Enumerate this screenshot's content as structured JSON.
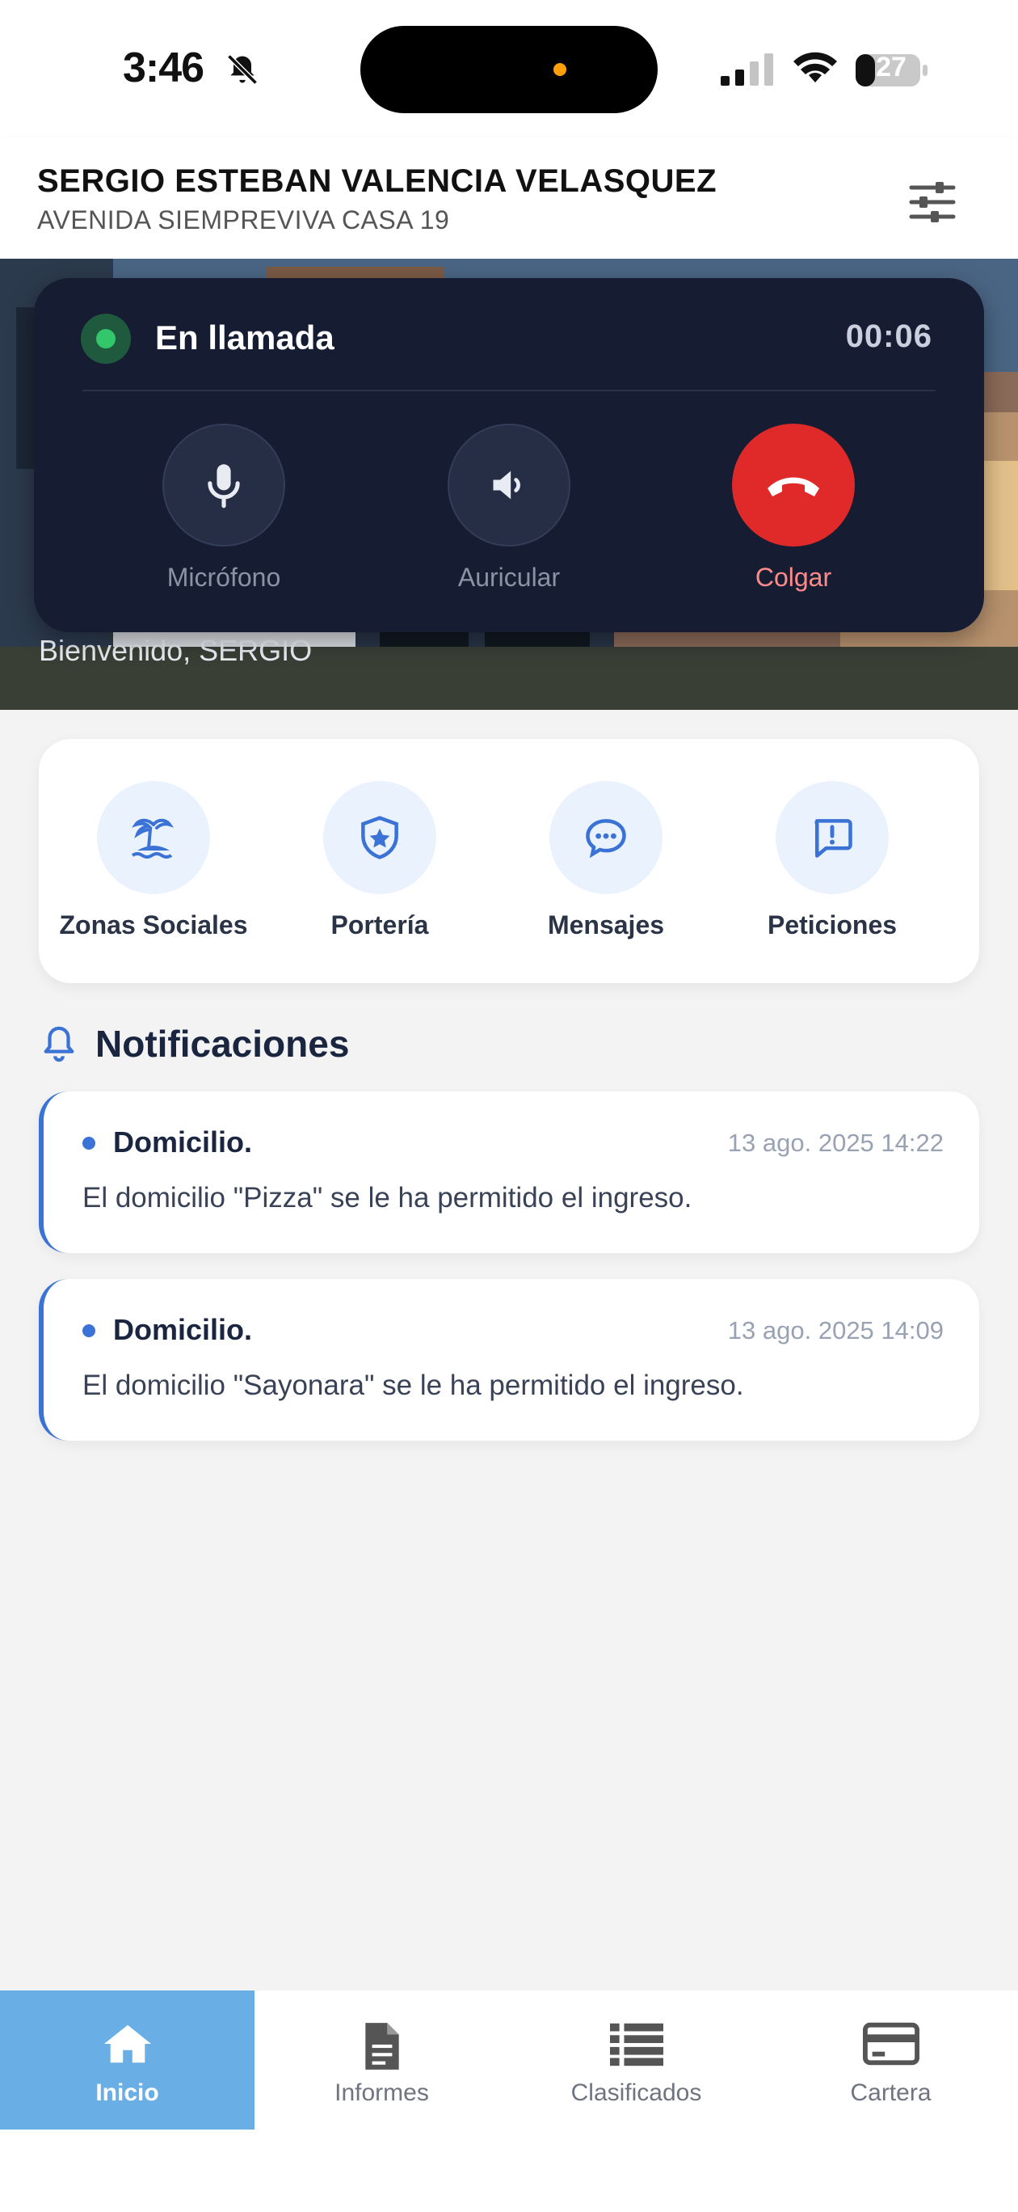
{
  "status_bar": {
    "time": "3:46",
    "battery": "27"
  },
  "header": {
    "name": "SERGIO ESTEBAN VALENCIA VELASQUEZ",
    "address": "AVENIDA SIEMPREVIVA CASA 19"
  },
  "hero": {
    "welcome": "Bienvenido, SERGIO"
  },
  "call": {
    "status": "En llamada",
    "timer": "00:06",
    "controls": [
      {
        "label": "Micrófono",
        "icon": "microphone-icon"
      },
      {
        "label": "Auricular",
        "icon": "speaker-icon"
      },
      {
        "label": "Colgar",
        "icon": "hang-up-icon"
      }
    ],
    "live_color": "#34c66a",
    "hangup_color": "#e02a2a"
  },
  "quick_actions": [
    {
      "label": "Zonas Sociales",
      "icon": "island-icon"
    },
    {
      "label": "Portería",
      "icon": "shield-star-icon"
    },
    {
      "label": "Mensajes",
      "icon": "chat-bubble-icon"
    },
    {
      "label": "Peticiones",
      "icon": "alert-message-icon"
    }
  ],
  "notifications": {
    "heading": "Notificaciones",
    "items": [
      {
        "title": "Domicilio.",
        "date": "13 ago. 2025 14:22",
        "body": "El domicilio \"Pizza\" se le ha permitido el ingreso."
      },
      {
        "title": "Domicilio.",
        "date": "13 ago. 2025 14:09",
        "body": "El domicilio \"Sayonara\" se le ha permitido el ingreso."
      }
    ]
  },
  "bottom_nav": {
    "active": "Inicio",
    "items": [
      {
        "label": "Inicio",
        "icon": "home-icon"
      },
      {
        "label": "Informes",
        "icon": "document-icon"
      },
      {
        "label": "Clasificados",
        "icon": "list-icon"
      },
      {
        "label": "Cartera",
        "icon": "card-icon"
      }
    ],
    "active_color": "#6aaee6"
  }
}
